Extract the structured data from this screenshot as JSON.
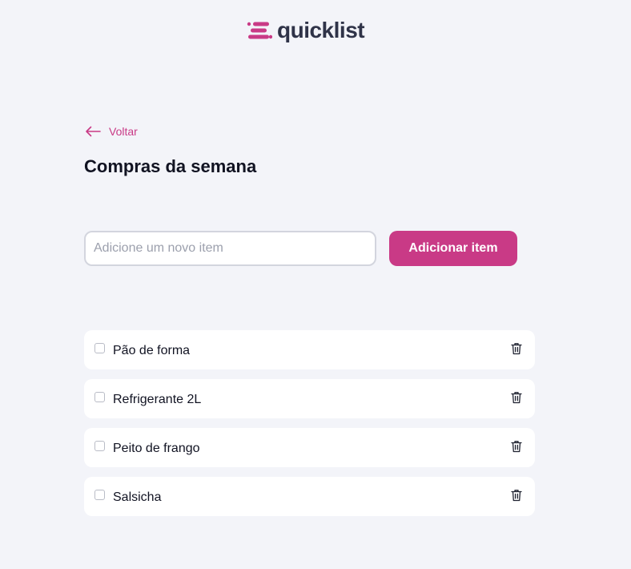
{
  "app": {
    "name": "quicklist",
    "brand_color": "#c93a86",
    "logo_icon": "list-lines-icon"
  },
  "nav": {
    "back_label": "Voltar",
    "back_icon": "arrow-left-icon"
  },
  "page": {
    "title": "Compras da semana"
  },
  "form": {
    "input_value": "",
    "input_placeholder": "Adicione um novo item",
    "submit_label": "Adicionar item"
  },
  "items": [
    {
      "label": "Pão de forma",
      "checked": false,
      "delete_icon": "trash-icon"
    },
    {
      "label": "Refrigerante 2L",
      "checked": false,
      "delete_icon": "trash-icon"
    },
    {
      "label": "Peito de frango",
      "checked": false,
      "delete_icon": "trash-icon"
    },
    {
      "label": "Salsicha",
      "checked": false,
      "delete_icon": "trash-icon"
    }
  ]
}
